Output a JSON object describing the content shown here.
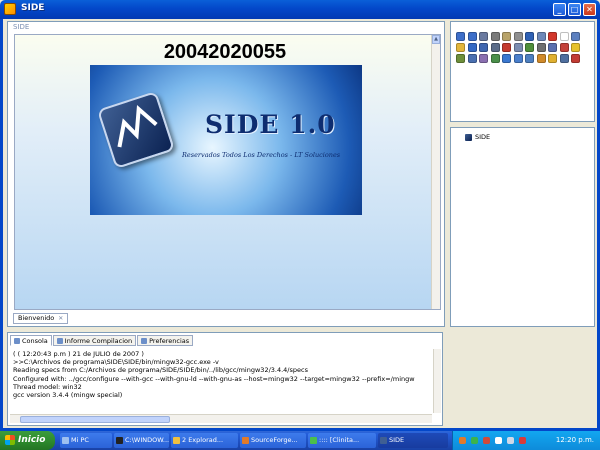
{
  "window": {
    "title": "SIDE"
  },
  "editor": {
    "panel_label": "SIDE",
    "big_number": "20042020055",
    "splash_title": "SIDE 1.0",
    "splash_subtitle": "Reservados Todos Los Derechos - LT Soluciones",
    "tab_label": "Bienvenido"
  },
  "toolbar": {
    "icons": [
      "undo-icon",
      "redo-icon",
      "cut-icon",
      "copy-icon",
      "paste-icon",
      "edit-icon",
      "search-icon",
      "find-replace-icon",
      "delete-icon",
      "new-file-icon",
      "window-icon",
      "open-folder-icon",
      "save-icon",
      "save-as-icon",
      "print-icon",
      "pdf-icon",
      "find-icon",
      "tag-icon",
      "format-icon",
      "database-icon",
      "run-icon",
      "lightning-icon",
      "indent-icon",
      "brace-icon",
      "list-icon",
      "grid-icon",
      "mail-icon",
      "table-icon",
      "cloud-icon",
      "pencil-icon",
      "help-icon",
      "settings-icon",
      "stop-icon"
    ],
    "icon_colors": [
      "#3d6ec9",
      "#3d6ec9",
      "#6a7aa0",
      "#7a7a7a",
      "#b8a36a",
      "#8f8f8f",
      "#2f61b5",
      "#6d87b8",
      "#d2372b",
      "#ffffff",
      "#5b7fbf",
      "#e3b63a",
      "#3469c4",
      "#3f66b0",
      "#5a6b88",
      "#c43a2d",
      "#7c8db0",
      "#4f8f3a",
      "#6f6f6f",
      "#5a6fae",
      "#c4413a",
      "#e6c22c",
      "#6e8f3a",
      "#4a6fb0",
      "#8a6fb0",
      "#4a8f4a",
      "#3b78d0",
      "#4a7fcc",
      "#4d7fbf",
      "#d08a2a",
      "#e0b030",
      "#4f6f9f",
      "#c23b33"
    ]
  },
  "tree": {
    "root_label": "SIDE"
  },
  "console": {
    "tabs": [
      "Consola",
      "Informe Compilacion",
      "Preferencias"
    ],
    "lines": [
      "( ( 12:20:43 p.m ) 21 de  JULIO  de 2007 )",
      ">>C:\\Archivos de programa\\SIDE\\SIDE/bin/mingw32-gcc.exe -v",
      "Reading specs from C:/Archivos de programa/SIDE/SIDE/bin/../lib/gcc/mingw32/3.4.4/specs",
      "Configured with: ../gcc/configure --with-gcc --with-gnu-ld --with-gnu-as --host=mingw32 --target=mingw32 --prefix=/mingw",
      "Thread model: win32",
      "gcc version 3.4.4 (mingw special)"
    ]
  },
  "taskbar": {
    "start_label": "Inicio",
    "buttons": [
      {
        "label": "Mi PC",
        "icon": "computer-icon",
        "color": "#9ec0f0"
      },
      {
        "label": "C:\\WINDOW...",
        "icon": "console-icon",
        "color": "#222222"
      },
      {
        "label": "2 Explorad...",
        "icon": "folder-icon",
        "color": "#f0c040"
      },
      {
        "label": "SourceForge...",
        "icon": "browser-icon",
        "color": "#e07a2a"
      },
      {
        "label": ":::: [Clinita...",
        "icon": "messenger-icon",
        "color": "#4bbf4b"
      },
      {
        "label": "SIDE",
        "icon": "side-app-icon",
        "color": "#3f5f93"
      }
    ],
    "tray_icons": [
      "firefox-tray-icon",
      "messenger-tray-icon",
      "users-tray-icon",
      "network-tray-icon",
      "volume-tray-icon",
      "security-tray-icon"
    ],
    "tray_colors": [
      "#e07a2a",
      "#3cb34b",
      "#d04a3a",
      "#ffffff",
      "#cfd8e8",
      "#d93a3a"
    ],
    "clock": "12:20 p.m."
  }
}
